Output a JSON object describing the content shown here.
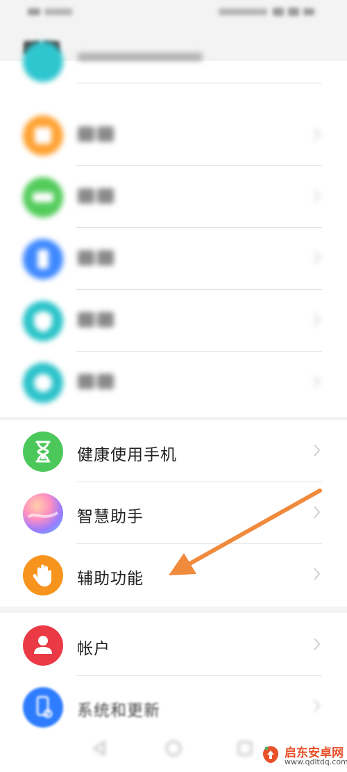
{
  "status_bar": {
    "left_text": "",
    "right_text": ""
  },
  "page": {
    "title": ""
  },
  "groups": [
    {
      "items": [
        {
          "name": "blurred-item-1",
          "label": "",
          "icon": "teal-icon",
          "color": "#2ec6cf"
        },
        {
          "name": "blurred-item-2",
          "label": "",
          "icon": "orange-grid-icon",
          "color": "#ffa233"
        },
        {
          "name": "blurred-item-3",
          "label": "",
          "icon": "green-battery-icon",
          "color": "#53cc5b"
        },
        {
          "name": "blurred-item-4",
          "label": "",
          "icon": "blue-storage-icon",
          "color": "#3d88ff"
        },
        {
          "name": "blurred-item-5",
          "label": "",
          "icon": "teal-security-icon",
          "color": "#29c3c8"
        },
        {
          "name": "blurred-item-6",
          "label": "",
          "icon": "teal-privacy-icon",
          "color": "#2bc2ca"
        }
      ]
    },
    {
      "items": [
        {
          "name": "digital-balance",
          "label": "健康使用手机",
          "icon": "hourglass-icon",
          "color": "#4cc85a"
        },
        {
          "name": "smart-assistant",
          "label": "智慧助手",
          "icon": "colorful-orb-icon",
          "color": "#b48cff"
        },
        {
          "name": "accessibility",
          "label": "辅助功能",
          "icon": "hand-icon",
          "color": "#f7941d"
        }
      ]
    },
    {
      "items": [
        {
          "name": "accounts",
          "label": "帐户",
          "icon": "person-icon",
          "color": "#ea3a45"
        },
        {
          "name": "system-update",
          "label": "系统和更新",
          "icon": "phone-gear-icon",
          "color": "#2f7dff"
        }
      ]
    }
  ],
  "annotation": {
    "color": "#f08a3c",
    "points_to": "accessibility"
  },
  "watermark": {
    "name": "启东安卓网",
    "url": "www.qdltdq.com",
    "brand_color": "#e8502a"
  }
}
